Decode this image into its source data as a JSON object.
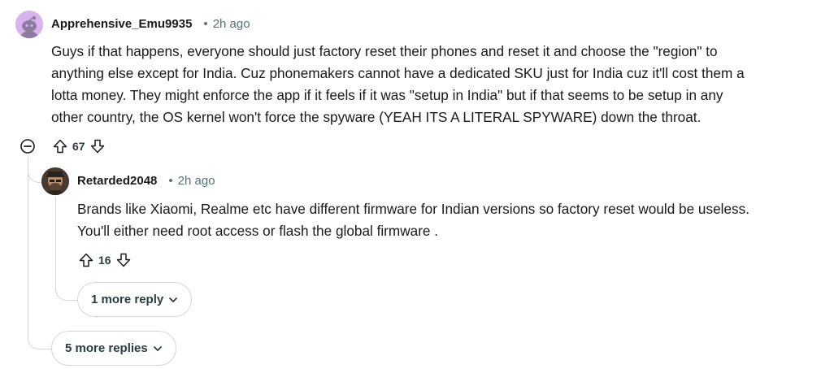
{
  "comments": [
    {
      "author": "Apprehensive_Emu9935",
      "separator": "•",
      "age": "2h ago",
      "body_lines": [
        "Guys if that happens, everyone should just factory reset their phones and reset it and choose the \"region\" to",
        "anything else except for India. Cuz phonemakers cannot have a dedicated SKU just for India cuz it'll cost them a",
        "lotta money. They might enforce the app if it feels if it was \"setup in India\" but if that seems to be setup in any",
        "other country, the OS kernel won't force the spyware (YEAH ITS A LITERAL SPYWARE) down the throat."
      ],
      "score": "67",
      "more_replies_label": "5 more replies"
    },
    {
      "author": "Retarded2048",
      "separator": "•",
      "age": "2h ago",
      "body_lines": [
        "Brands like Xiaomi, Realme etc have different firmware for Indian versions so factory reset would be useless.",
        "You'll either need root access or flash the global firmware ."
      ],
      "score": "16",
      "more_replies_label": "1 more reply"
    }
  ],
  "icons": {
    "upvote": "arrow-up-outline-icon",
    "downvote": "arrow-down-outline-icon",
    "collapse": "minus-circle-icon",
    "expand": "chevron-down-icon"
  },
  "colors": {
    "text": "#1a1a1b",
    "meta": "#576f76",
    "thread": "#d4d7d9",
    "avatar_bg": "#d8b3f0"
  }
}
